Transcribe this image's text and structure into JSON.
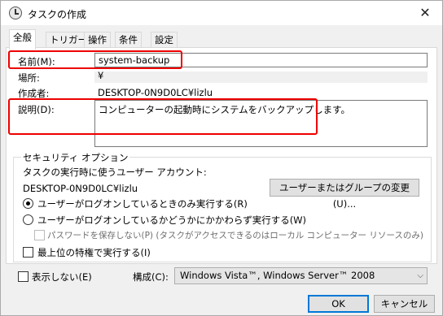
{
  "window": {
    "title": "タスクの作成"
  },
  "tabs": [
    "全般",
    "トリガー",
    "操作",
    "条件",
    "設定"
  ],
  "general": {
    "name_label": "名前(M):",
    "name_value": "system-backup",
    "location_label": "場所:",
    "location_value": "¥",
    "author_label": "作成者:",
    "author_value": "DESKTOP-0N9D0LC¥lizlu",
    "description_label": "説明(D):",
    "description_value": "コンピューターの起動時にシステムをバックアップします。"
  },
  "security": {
    "group_label": "セキュリティ オプション",
    "account_prompt": "タスクの実行時に使うユーザー アカウント:",
    "account_value": "DESKTOP-0N9D0LC¥lizlu",
    "change_user_button": "ユーザーまたはグループの変更(U)...",
    "radio_logged_on": "ユーザーがログオンしているときのみ実行する(R)",
    "radio_any": "ユーザーがログオンしているかどうかにかかわらず実行する(W)",
    "no_store_password": "パスワードを保存しない(P) (タスクがアクセスできるのはローカル コンピューター リソースのみ)",
    "highest_privileges": "最上位の特権で実行する(I)"
  },
  "bottom": {
    "hidden_label": "表示しない(E)",
    "configure_label": "構成(C):",
    "configure_value": "Windows Vista™, Windows Server™ 2008"
  },
  "buttons": {
    "ok": "OK",
    "cancel": "キャンセル"
  }
}
